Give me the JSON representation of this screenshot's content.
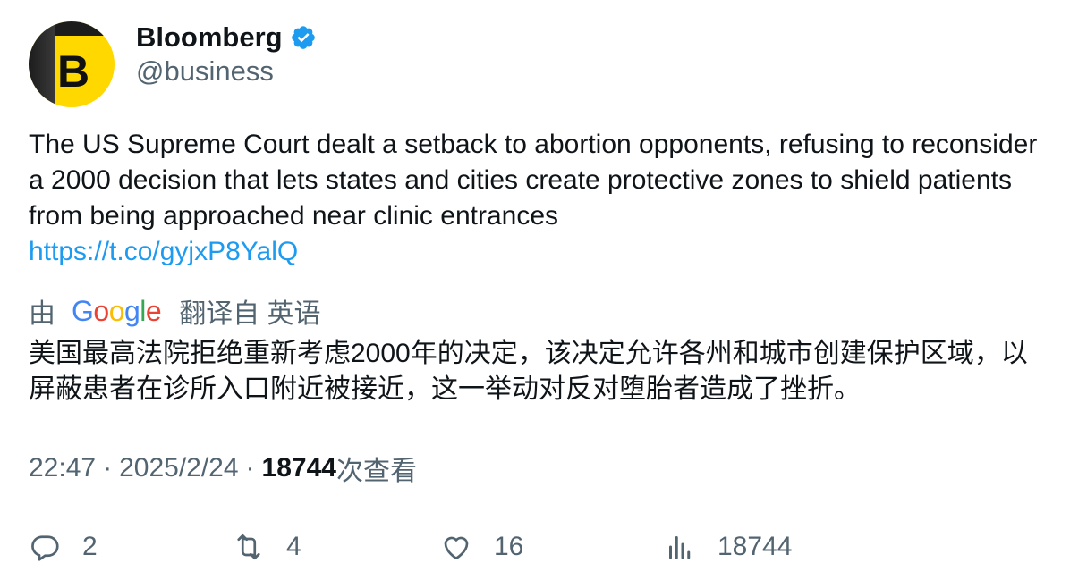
{
  "author": {
    "display_name": "Bloomberg",
    "handle": "@business",
    "avatar_letter": "B",
    "verified": true,
    "verified_color": "#1d9bf0",
    "avatar_color": "#ffd800"
  },
  "tweet": {
    "text": "The US Supreme Court dealt a setback to abortion opponents, refusing to reconsider a 2000 decision that lets states and cities create protective zones to shield patients from being approached near clinic entrances",
    "link": "https://t.co/gyjxP8YalQ",
    "link_color": "#1d9bf0"
  },
  "translation": {
    "prefix": "由",
    "provider": "Google",
    "suffix": "翻译自 英语",
    "text": "美国最高法院拒绝重新考虑2000年的决定，该决定允许各州和城市创建保护区域，以屏蔽患者在诊所入口附近被接近，这一举动对反对堕胎者造成了挫折。"
  },
  "meta": {
    "time": "22:47",
    "separator": "·",
    "date": "2025/2/24",
    "views_count": "18744",
    "views_label": "次查看"
  },
  "actions": {
    "replies": "2",
    "retweets": "4",
    "likes": "16",
    "views": "18744"
  },
  "icons": {
    "reply": "reply-icon",
    "retweet": "retweet-icon",
    "like": "heart-icon",
    "views": "analytics-icon",
    "verified": "verified-badge-icon"
  }
}
